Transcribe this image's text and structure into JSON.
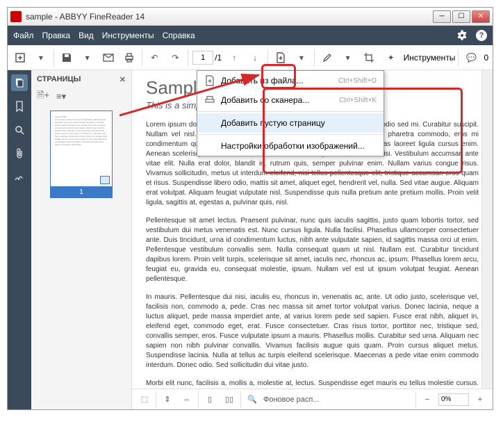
{
  "window_title": "sample - ABBYY FineReader 14",
  "menubar": [
    "Файл",
    "Правка",
    "Вид",
    "Инструменты",
    "Справка"
  ],
  "toolbar": {
    "page_current": "1",
    "page_total": "/1",
    "tools_button": "Инструменты",
    "badge": "0"
  },
  "sidebar": {
    "title": "СТРАНИЦЫ",
    "thumb_number": "1"
  },
  "dropdown": [
    {
      "label": "Добавить из файла...",
      "u": "Д",
      "shortcut": "Ctrl+Shift+O",
      "icon": "add-from-file"
    },
    {
      "label": "Добавить со сканера...",
      "u": "",
      "shortcut": "Ctrl+Shift+K",
      "icon": "add-from-scanner"
    },
    {
      "sep": true
    },
    {
      "label": "Добавить пустую страницу",
      "u": "",
      "shortcut": "",
      "hover": true
    },
    {
      "sep": true
    },
    {
      "label": "Настройки обработки изображений...",
      "u": "Н",
      "shortcut": ""
    }
  ],
  "document": {
    "title": "Sample PDF",
    "subtitle": "This is a simple PDF file. Fun fun fun.",
    "p1": "Lorem ipsum dolor sit amet, consectetuer adipiscing elit. Phasellus facilisis odio sed mi. Curabitur suscipit. Nullam vel nisl. Etiam semper ipsum ut lectus. Proin aliquam, erat eget pharetra commodo, eros mi condimentum quam, sed commodo justo quam ut velit. Integer a erat. Cras laoreet ligula cursus enim. Aenean scelerisque velit et tellus. Vestibulum dictum aliquet sem. Nulla facilisi. Vestibulum accumsan ante vitae elit. Nulla erat dolor, blandit in, rutrum quis, semper pulvinar enim. Nullam varius congue risus. Vivamus sollicitudin, metus ut interdum eleifend, nisi tellus pellentesque elit, tristique accumsan eros quam et risus. Suspendisse libero odio, mattis sit amet, aliquet eget, hendrerit vel, nulla. Sed vitae augue. Aliquam erat volutpat. Aliquam feugiat vulputate nisl. Suspendisse quis nulla pretium ante pretium mollis. Proin velit ligula, sagittis at, egestas a, pulvinar quis, nisl.",
    "p2": "Pellentesque sit amet lectus. Praesent pulvinar, nunc quis iaculis sagittis, justo quam lobortis tortor, sed vestibulum dui metus venenatis est. Nunc cursus ligula. Nulla facilisi. Phasellus ullamcorper consectetuer ante. Duis tincidunt, urna id condimentum luctus, nibh ante vulputate sapien, id sagittis massa orci ut enim. Pellentesque vestibulum convallis sem. Nulla consequat quam ut nisl. Nullam est. Curabitur tincidunt dapibus lorem. Proin velit turpis, scelerisque sit amet, iaculis nec, rhoncus ac, ipsum. Phasellus lorem arcu, feugiat eu, gravida eu, consequat molestie, ipsum. Nullam vel est ut ipsum volutpat feugiat. Aenean pellentesque.",
    "p3": "In mauris. Pellentesque dui nisi, iaculis eu, rhoncus in, venenatis ac, ante. Ut odio justo, scelerisque vel, facilisis non, commodo a, pede. Cras nec massa sit amet tortor volutpat varius. Donec lacinia, neque a luctus aliquet, pede massa imperdiet ante, at varius lorem pede sed sapien. Fusce erat nibh, aliquet in, eleifend eget, commodo eget, erat. Fusce consectetuer. Cras risus tortor, porttitor nec, tristique sed, convallis semper, eros. Fusce vulputate ipsum a mauris. Phasellus mollis. Curabitur sed urna. Aliquam nec sapien non nibh pulvinar convallis. Vivamus facilisis augue quis quam. Proin cursus aliquet metus. Suspendisse lacinia. Nulla at tellus ac turpis eleifend scelerisque. Maecenas a pede vitae enim commodo interdum. Donec odio. Sed sollicitudin dui vitae justo.",
    "p4": "Morbi elit nunc, facilisis a, mollis a, molestie at, lectus. Suspendisse eget mauris eu tellus molestie cursus. Duis ut magna at justo dignissim condimentum. Cum sociis natoque"
  },
  "statusbar": {
    "fit_label": "Фоновое расп...",
    "zoom": "0%"
  }
}
